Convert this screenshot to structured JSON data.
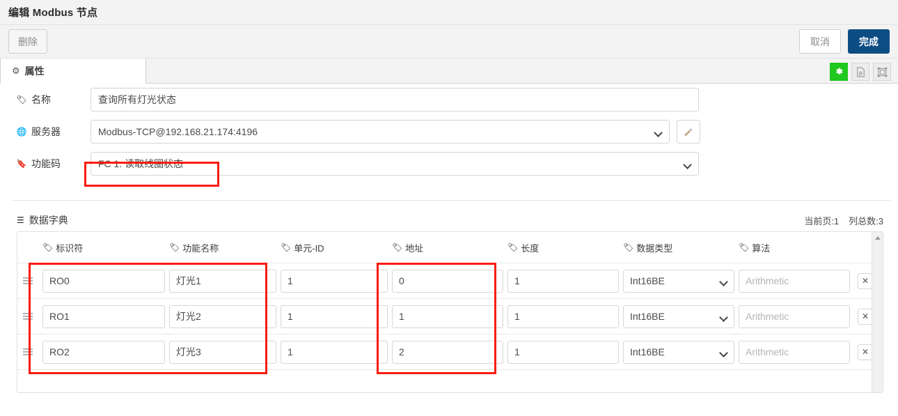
{
  "window": {
    "title": "编辑 Modbus 节点"
  },
  "toolbar": {
    "delete_label": "删除",
    "cancel_label": "取消",
    "done_label": "完成"
  },
  "tabs": [
    {
      "label": "属性",
      "icon": "gear-icon",
      "active": true
    }
  ],
  "tool_icons": [
    {
      "name": "gear-icon",
      "glyph": "⚙",
      "active": true,
      "color": "#1ec81e"
    },
    {
      "name": "description-icon",
      "glyph": "὜E",
      "active": false
    },
    {
      "name": "layout-icon",
      "glyph": "⧉",
      "active": false
    }
  ],
  "form": {
    "name": {
      "label": "名称",
      "icon": "tag-icon",
      "value": "查询所有灯光状态"
    },
    "server": {
      "label": "服务器",
      "icon": "globe-icon",
      "value": "Modbus-TCP@192.168.21.174:4196",
      "edit_button": "pencil-icon"
    },
    "function_code": {
      "label": "功能码",
      "icon": "bookmark-icon",
      "value": "FC 1: 读取线圈状态"
    }
  },
  "data_dictionary": {
    "title": "数据字典",
    "icon": "list-icon",
    "current_page_label": "当前页:1",
    "total_columns_label": "列总数:3",
    "columns": [
      {
        "label": "标识符"
      },
      {
        "label": "功能名称"
      },
      {
        "label": "单元-ID"
      },
      {
        "label": "地址"
      },
      {
        "label": "长度"
      },
      {
        "label": "数据类型"
      },
      {
        "label": "算法"
      }
    ],
    "rows": [
      {
        "identifier": "RO0",
        "function_name": "灯光1",
        "unit_id": "1",
        "address": "0",
        "length": "1",
        "data_type": "Int16BE",
        "algorithm": "",
        "algorithm_placeholder": "Arithmetic",
        "delete": "✕"
      },
      {
        "identifier": "RO1",
        "function_name": "灯光2",
        "unit_id": "1",
        "address": "1",
        "length": "1",
        "data_type": "Int16BE",
        "algorithm": "",
        "algorithm_placeholder": "Arithmetic",
        "delete": "✕"
      },
      {
        "identifier": "RO2",
        "function_name": "灯光3",
        "unit_id": "1",
        "address": "2",
        "length": "1",
        "data_type": "Int16BE",
        "algorithm": "",
        "algorithm_placeholder": "Arithmetic",
        "delete": "✕"
      }
    ]
  },
  "annotations": {
    "color": "#fc1b0f",
    "boxes": [
      {
        "name": "function-code-highlight"
      },
      {
        "name": "identifier-columns-highlight"
      },
      {
        "name": "address-column-highlight"
      }
    ]
  }
}
